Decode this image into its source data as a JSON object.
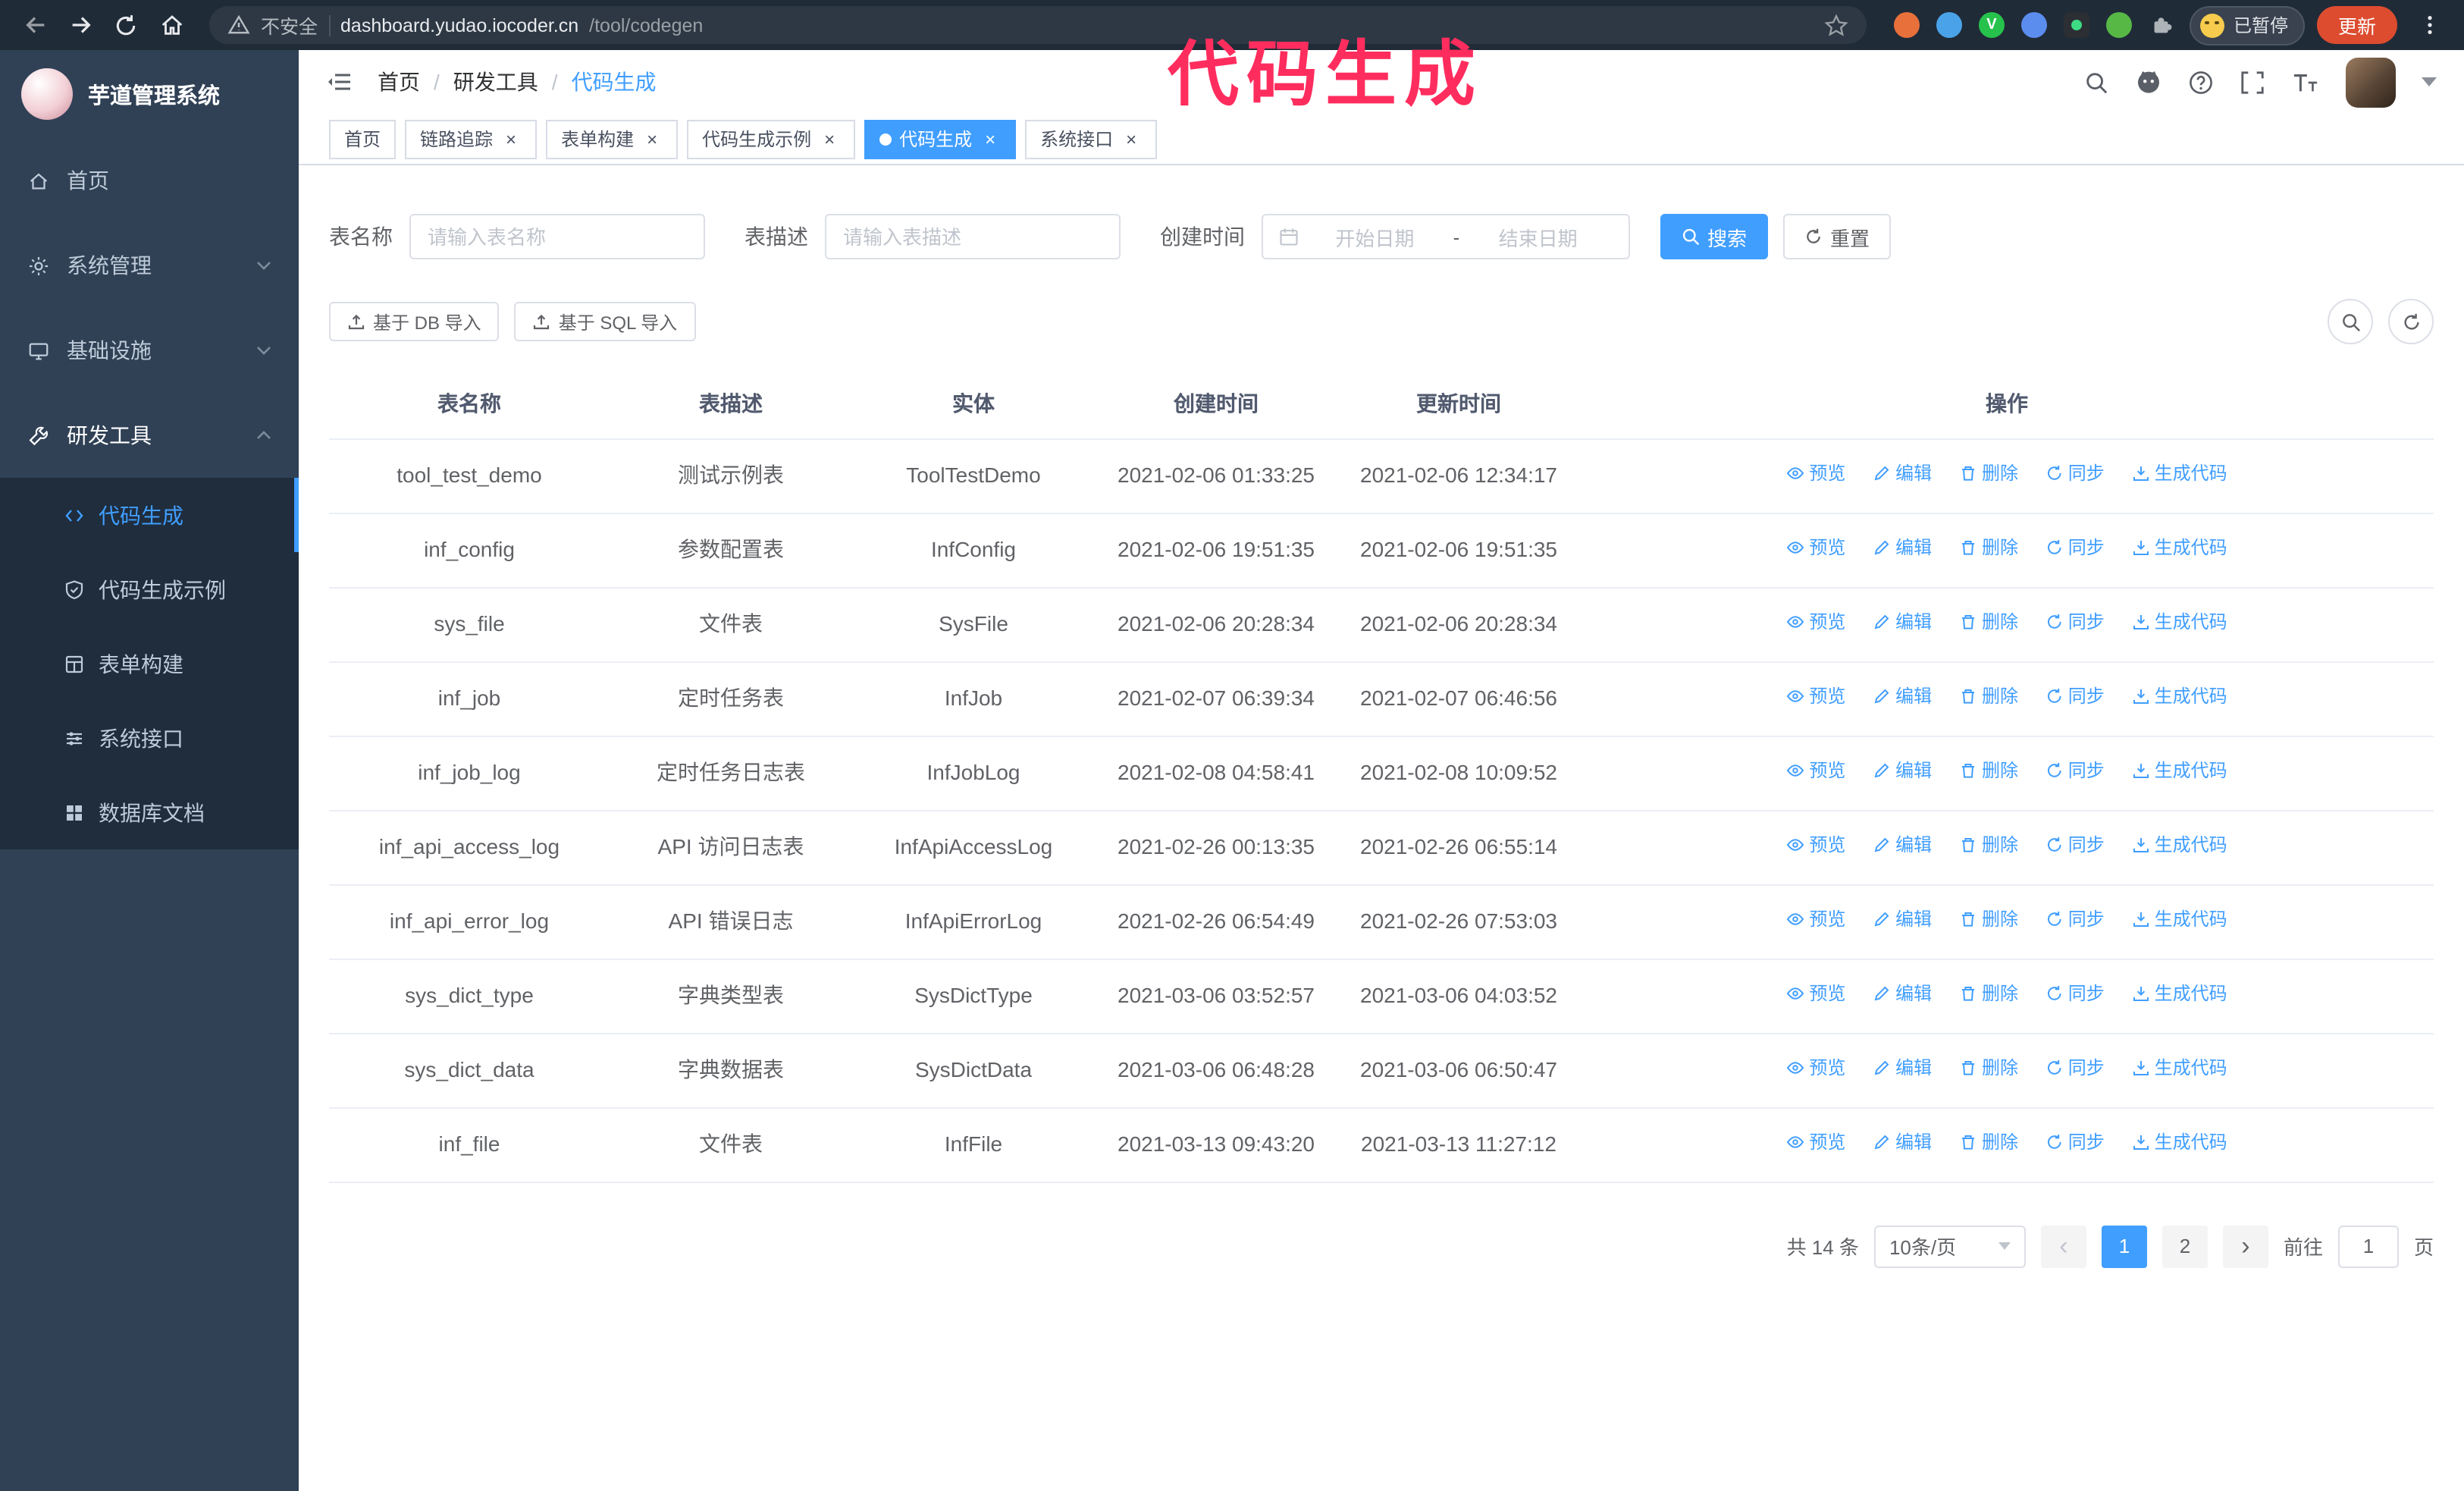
{
  "colors": {
    "primary": "#409EFF",
    "annotation": "#ff2d5e",
    "sidebar_bg": "#304156",
    "submenu_bg": "#1f2d3d",
    "chrome_bg": "#202b38",
    "update_button": "#dd4c2f"
  },
  "browser": {
    "security_text": "不安全",
    "url_host": "dashboard.yudao.iocoder.cn",
    "url_path": "/tool/codegen",
    "paused_label": "已暂停",
    "update_label": "更新"
  },
  "annotation": {
    "text": "代码生成"
  },
  "sidebar": {
    "logo_title": "芋道管理系统",
    "items": [
      {
        "label": "首页",
        "expandable": false
      },
      {
        "label": "系统管理",
        "expandable": true,
        "expanded": false
      },
      {
        "label": "基础设施",
        "expandable": true,
        "expanded": false
      },
      {
        "label": "研发工具",
        "expandable": true,
        "expanded": true
      }
    ],
    "submenu": [
      {
        "label": "代码生成",
        "active": true
      },
      {
        "label": "代码生成示例",
        "active": false
      },
      {
        "label": "表单构建",
        "active": false
      },
      {
        "label": "系统接口",
        "active": false
      },
      {
        "label": "数据库文档",
        "active": false
      }
    ]
  },
  "header": {
    "breadcrumb": [
      "首页",
      "研发工具",
      "代码生成"
    ],
    "breadcrumb_separator": "/"
  },
  "tabs": [
    {
      "label": "首页",
      "closable": false,
      "active": false
    },
    {
      "label": "链路追踪",
      "closable": true,
      "active": false
    },
    {
      "label": "表单构建",
      "closable": true,
      "active": false
    },
    {
      "label": "代码生成示例",
      "closable": true,
      "active": false
    },
    {
      "label": "代码生成",
      "closable": true,
      "active": true
    },
    {
      "label": "系统接口",
      "closable": true,
      "active": false
    }
  ],
  "filters": {
    "table_name_label": "表名称",
    "table_name_placeholder": "请输入表名称",
    "table_desc_label": "表描述",
    "table_desc_placeholder": "请输入表描述",
    "create_time_label": "创建时间",
    "date_start_placeholder": "开始日期",
    "date_separator": "-",
    "date_end_placeholder": "结束日期",
    "search_button": "搜索",
    "reset_button": "重置"
  },
  "toolbar": {
    "import_db_label": "基于 DB 导入",
    "import_sql_label": "基于 SQL 导入"
  },
  "table": {
    "columns": [
      "表名称",
      "表描述",
      "实体",
      "创建时间",
      "更新时间",
      "操作"
    ],
    "actions": [
      "预览",
      "编辑",
      "删除",
      "同步",
      "生成代码"
    ],
    "rows": [
      {
        "name": "tool_test_demo",
        "desc": "测试示例表",
        "entity": "ToolTestDemo",
        "created": "2021-02-06 01:33:25",
        "updated": "2021-02-06 12:34:17"
      },
      {
        "name": "inf_config",
        "desc": "参数配置表",
        "entity": "InfConfig",
        "created": "2021-02-06 19:51:35",
        "updated": "2021-02-06 19:51:35"
      },
      {
        "name": "sys_file",
        "desc": "文件表",
        "entity": "SysFile",
        "created": "2021-02-06 20:28:34",
        "updated": "2021-02-06 20:28:34"
      },
      {
        "name": "inf_job",
        "desc": "定时任务表",
        "entity": "InfJob",
        "created": "2021-02-07 06:39:34",
        "updated": "2021-02-07 06:46:56"
      },
      {
        "name": "inf_job_log",
        "desc": "定时任务日志表",
        "entity": "InfJobLog",
        "created": "2021-02-08 04:58:41",
        "updated": "2021-02-08 10:09:52"
      },
      {
        "name": "inf_api_access_log",
        "desc": "API 访问日志表",
        "entity": "InfApiAccessLog",
        "created": "2021-02-26 00:13:35",
        "updated": "2021-02-26 06:55:14"
      },
      {
        "name": "inf_api_error_log",
        "desc": "API 错误日志",
        "entity": "InfApiErrorLog",
        "created": "2021-02-26 06:54:49",
        "updated": "2021-02-26 07:53:03"
      },
      {
        "name": "sys_dict_type",
        "desc": "字典类型表",
        "entity": "SysDictType",
        "created": "2021-03-06 03:52:57",
        "updated": "2021-03-06 04:03:52"
      },
      {
        "name": "sys_dict_data",
        "desc": "字典数据表",
        "entity": "SysDictData",
        "created": "2021-03-06 06:48:28",
        "updated": "2021-03-06 06:50:47"
      },
      {
        "name": "inf_file",
        "desc": "文件表",
        "entity": "InfFile",
        "created": "2021-03-13 09:43:20",
        "updated": "2021-03-13 11:27:12"
      }
    ]
  },
  "pagination": {
    "total_label": "共 14 条",
    "page_size_label": "10条/页",
    "pages": [
      "1",
      "2"
    ],
    "active_page": "1",
    "goto_label": "前往",
    "goto_value": "1",
    "goto_unit": "页"
  }
}
